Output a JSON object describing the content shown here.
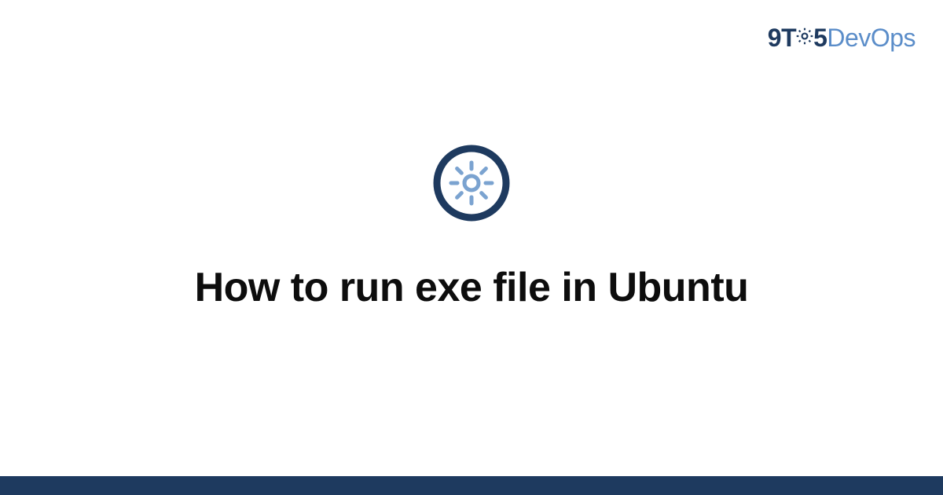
{
  "logo": {
    "part1": "9T",
    "part2": "5",
    "part3": "DevOps",
    "gear_icon": "gear-icon"
  },
  "center": {
    "icon": "settings-gear-icon",
    "title": "How to run exe file in Ubuntu"
  },
  "colors": {
    "dark_navy": "#1e3a5f",
    "light_blue": "#5b8dc9",
    "text_black": "#0d0d0d"
  }
}
